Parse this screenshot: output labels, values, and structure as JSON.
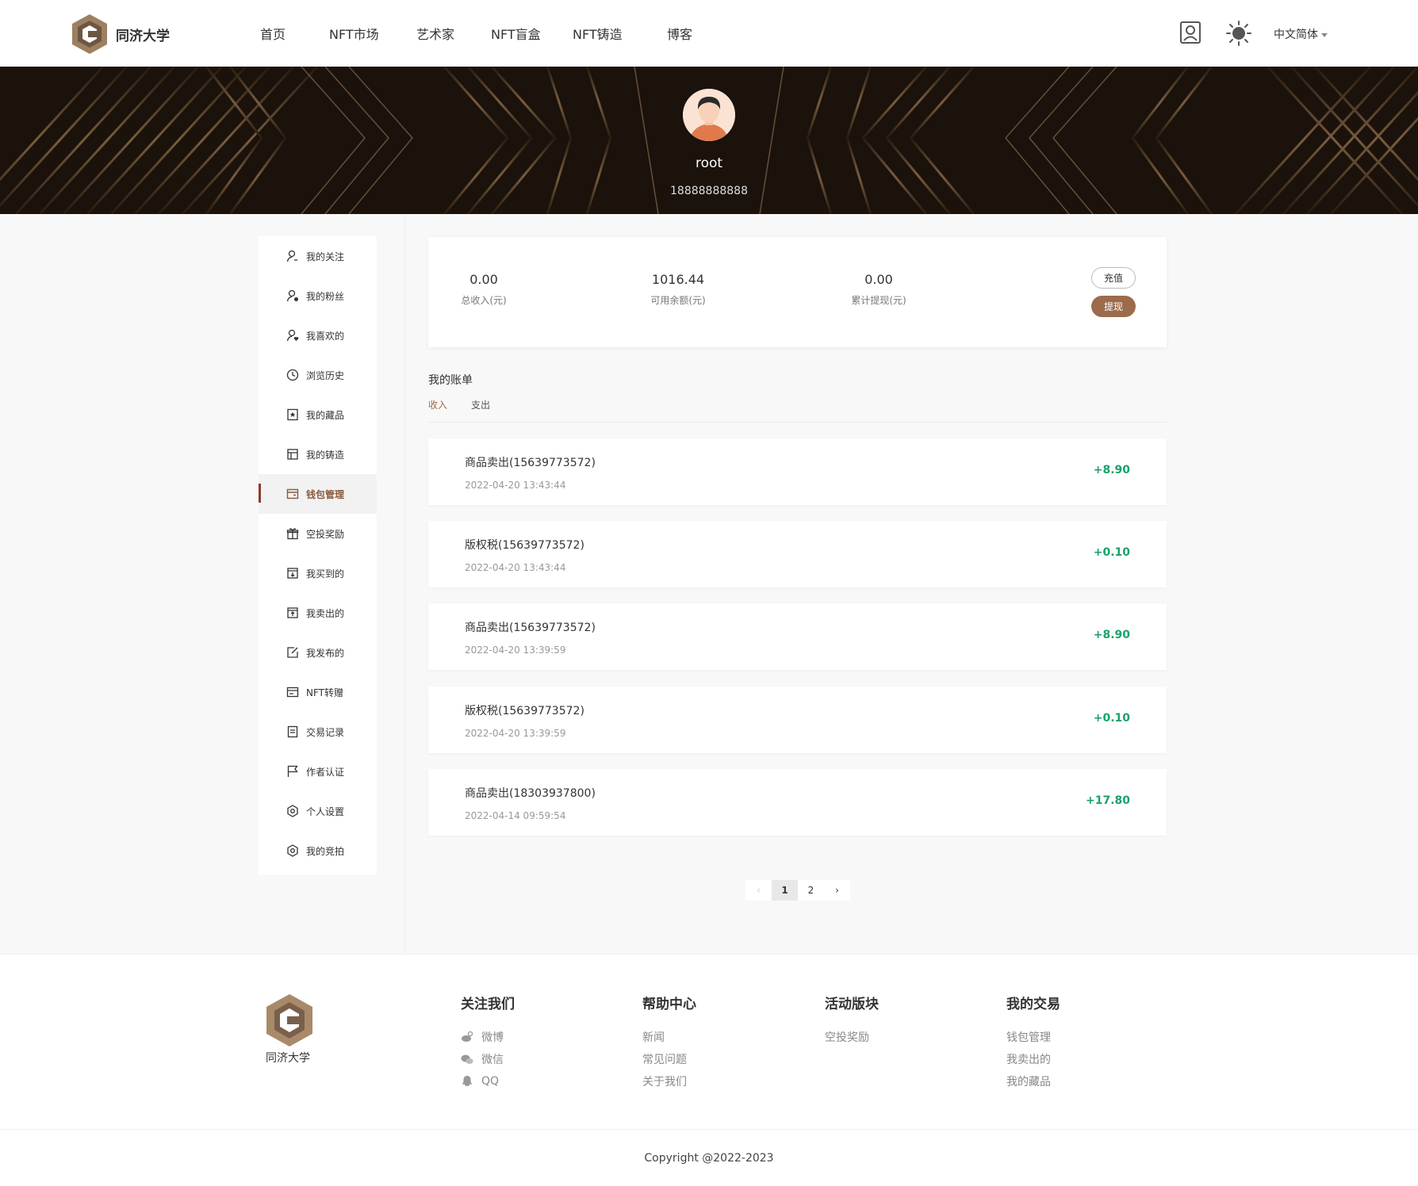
{
  "header": {
    "brand": "同济大学",
    "nav": [
      "首页",
      "NFT市场",
      "艺术家",
      "NFT盲盒",
      "NFT铸造",
      "博客"
    ],
    "language": "中文简体"
  },
  "profile": {
    "username": "root",
    "phone": "18888888888"
  },
  "sidebar": {
    "items": [
      "我的关注",
      "我的粉丝",
      "我喜欢的",
      "浏览历史",
      "我的藏品",
      "我的铸造",
      "钱包管理",
      "空投奖励",
      "我买到的",
      "我卖出的",
      "我发布的",
      "NFT转赠",
      "交易记录",
      "作者认证",
      "个人设置",
      "我的竞拍"
    ],
    "active": "钱包管理"
  },
  "wallet": {
    "total_income": "0.00",
    "total_income_label": "总收入(元)",
    "balance": "1016.44",
    "balance_label": "可用余额(元)",
    "withdrawn": "0.00",
    "withdrawn_label": "累计提现(元)",
    "recharge_label": "充值",
    "withdraw_label": "提现"
  },
  "bills": {
    "title": "我的账单",
    "tabs": [
      "收入",
      "支出"
    ],
    "rows": [
      {
        "title": "商品卖出(15639773572)",
        "date": "2022-04-20 13:43:44",
        "amount": "+8.90"
      },
      {
        "title": "版权税(15639773572)",
        "date": "2022-04-20 13:43:44",
        "amount": "+0.10"
      },
      {
        "title": "商品卖出(15639773572)",
        "date": "2022-04-20 13:39:59",
        "amount": "+8.90"
      },
      {
        "title": "版权税(15639773572)",
        "date": "2022-04-20 13:39:59",
        "amount": "+0.10"
      },
      {
        "title": "商品卖出(18303937800)",
        "date": "2022-04-14 09:59:54",
        "amount": "+17.80"
      }
    ]
  },
  "pagination": {
    "prev": "‹",
    "pages": [
      "1",
      "2"
    ],
    "next": "›",
    "current": "1"
  },
  "footer": {
    "brand": "同济大学",
    "cols": [
      {
        "title": "关注我们",
        "links": [
          "微博",
          "微信",
          "QQ"
        ]
      },
      {
        "title": "帮助中心",
        "links": [
          "新闻",
          "常见问题",
          "关于我们"
        ]
      },
      {
        "title": "活动版块",
        "links": [
          "空投奖励"
        ]
      },
      {
        "title": "我的交易",
        "links": [
          "钱包管理",
          "我卖出的",
          "我的藏品"
        ]
      }
    ],
    "copyright": "Copyright @2022-2023"
  },
  "colors": {
    "accent": "#9b6b4c",
    "positive": "#1aa26a",
    "active_bar": "#8a3b2a"
  }
}
